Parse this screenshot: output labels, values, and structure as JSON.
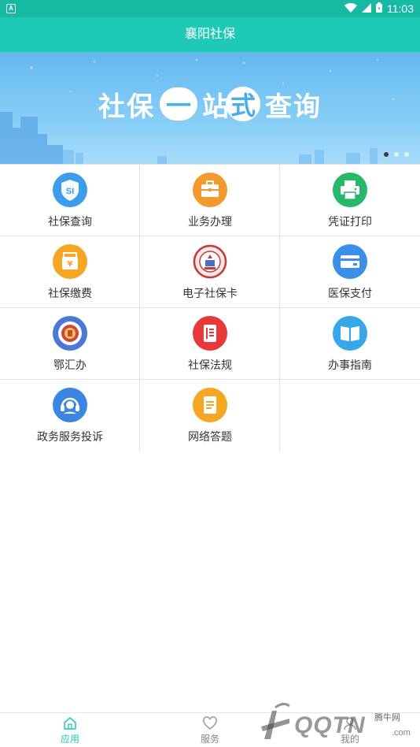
{
  "status_bar": {
    "time": "11:03",
    "notification_icon": "A"
  },
  "header": {
    "title": "襄阳社保"
  },
  "banner": {
    "text_parts": [
      "社保",
      "一",
      "站",
      "式",
      "查询"
    ],
    "slides": 3,
    "active_slide": 1
  },
  "grid": {
    "items": [
      {
        "label": "社保查询",
        "icon": "si-shield-icon",
        "color": "#3e9cec"
      },
      {
        "label": "业务办理",
        "icon": "briefcase-icon",
        "color": "#f29a2e"
      },
      {
        "label": "凭证打印",
        "icon": "printer-icon",
        "color": "#28b86b"
      },
      {
        "label": "社保缴费",
        "icon": "payment-box-icon",
        "color": "#f5a623"
      },
      {
        "label": "电子社保卡",
        "icon": "social-security-seal-icon",
        "color": "#c73a3a"
      },
      {
        "label": "医保支付",
        "icon": "card-icon",
        "color": "#3b8fe8"
      },
      {
        "label": "鄂汇办",
        "icon": "ehuiban-emblem-icon",
        "color": "#4a78d6"
      },
      {
        "label": "社保法规",
        "icon": "document-icon",
        "color": "#e8383a"
      },
      {
        "label": "办事指南",
        "icon": "book-icon",
        "color": "#38a7ea"
      },
      {
        "label": "政务服务投诉",
        "icon": "headset-icon",
        "color": "#3a86e0"
      },
      {
        "label": "网络答题",
        "icon": "notepad-icon",
        "color": "#f5a623"
      }
    ]
  },
  "tab_bar": {
    "tabs": [
      {
        "label": "应用",
        "icon": "home-icon",
        "active": true
      },
      {
        "label": "服务",
        "icon": "heart-icon",
        "active": false
      },
      {
        "label": "我的",
        "icon": "user-icon",
        "active": false
      }
    ]
  },
  "watermark": {
    "logo_text": "QQTN",
    "site_name": "腾牛网",
    "domain": ".com"
  }
}
